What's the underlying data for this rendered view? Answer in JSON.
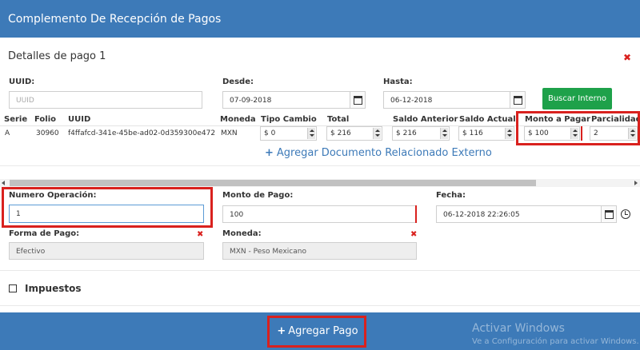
{
  "colors": {
    "header": "#3d7ab8",
    "accent_green": "#1ea14a",
    "highlight_red": "#d9211e"
  },
  "window": {
    "title": "Complemento De Recepción de Pagos"
  },
  "details": {
    "title": "Detalles de pago 1",
    "uuid": {
      "label": "UUID:",
      "placeholder": "UUID"
    },
    "desde": {
      "label": "Desde:",
      "value": "07-09-2018"
    },
    "hasta": {
      "label": "Hasta:",
      "value": "06-12-2018"
    },
    "search_button": "Buscar Interno"
  },
  "table": {
    "headers": [
      "Serie",
      "Folio",
      "UUID",
      "Moneda",
      "Tipo Cambio",
      "Total",
      "Saldo Anterior",
      "Saldo Actual",
      "Monto a Pagar",
      "Parcialidad"
    ],
    "row": {
      "serie": "A",
      "folio": "30960",
      "uuid": "f4ffafcd-341e-45be-ad02-0d359300e472",
      "moneda": "MXN",
      "tipo_cambio": "$ 0",
      "total": "$ 216",
      "saldo_anterior": "$ 216",
      "saldo_actual": "$ 116",
      "monto_pagar": "$ 100",
      "parcialidad": "2"
    }
  },
  "add_external_link": "Agregar Documento Relacionado Externo",
  "payment": {
    "numero_operacion": {
      "label": "Numero Operación:",
      "value": "1"
    },
    "monto_pago": {
      "label": "Monto de Pago:",
      "value": "100"
    },
    "fecha": {
      "label": "Fecha:",
      "value": "06-12-2018 22:26:05"
    },
    "forma_pago": {
      "label": "Forma de Pago:",
      "value": "Efectivo"
    },
    "moneda": {
      "label": "Moneda:",
      "value": "MXN - Peso Mexicano"
    }
  },
  "impuestos_label": "Impuestos",
  "footer": {
    "add_button": "Agregar Pago"
  },
  "watermark": {
    "line1": "Activar Windows",
    "line2": "Ve a Configuración para activar Windows."
  }
}
